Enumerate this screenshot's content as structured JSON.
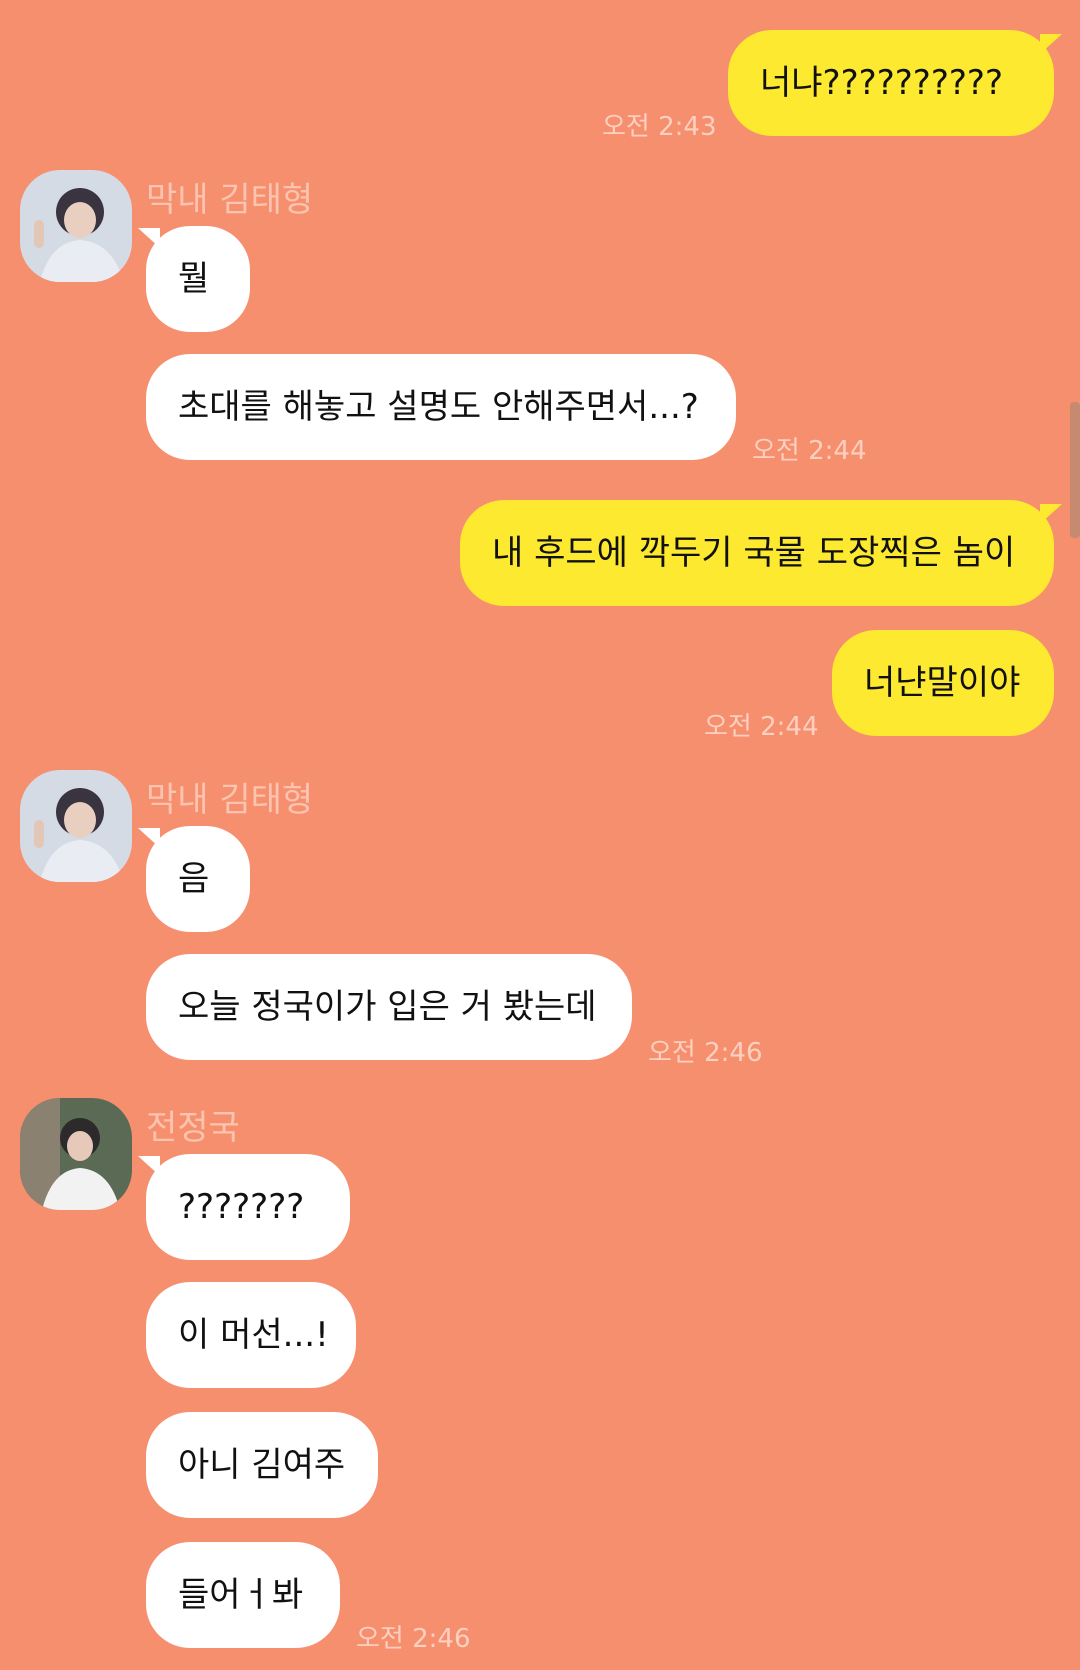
{
  "chat": {
    "msg1": {
      "text": "너냐??????????",
      "time": "오전 2:43"
    },
    "group_v1": {
      "sender": "막내 김태형",
      "msg1": "뭘",
      "msg2": "초대를 해놓고 설명도 안해주면서...?",
      "time": "오전 2:44"
    },
    "msg2": {
      "text": "내 후드에 깍두기 국물 도장찍은 놈이"
    },
    "msg3": {
      "text": "너냔말이야",
      "time": "오전 2:44"
    },
    "group_v2": {
      "sender": "막내 김태형",
      "msg1": "음",
      "msg2": "오늘 정국이가 입은 거 봤는데",
      "time": "오전 2:46"
    },
    "group_jk": {
      "sender": "전정국",
      "msg1": "???????",
      "msg2": "이 머선...!",
      "msg3": "아니 김여주",
      "msg4": "들어ㅓ봐",
      "time": "오전 2:46"
    }
  },
  "colors": {
    "background": "#f68f6e",
    "outgoing_bubble": "#fde92f",
    "incoming_bubble": "#ffffff"
  }
}
